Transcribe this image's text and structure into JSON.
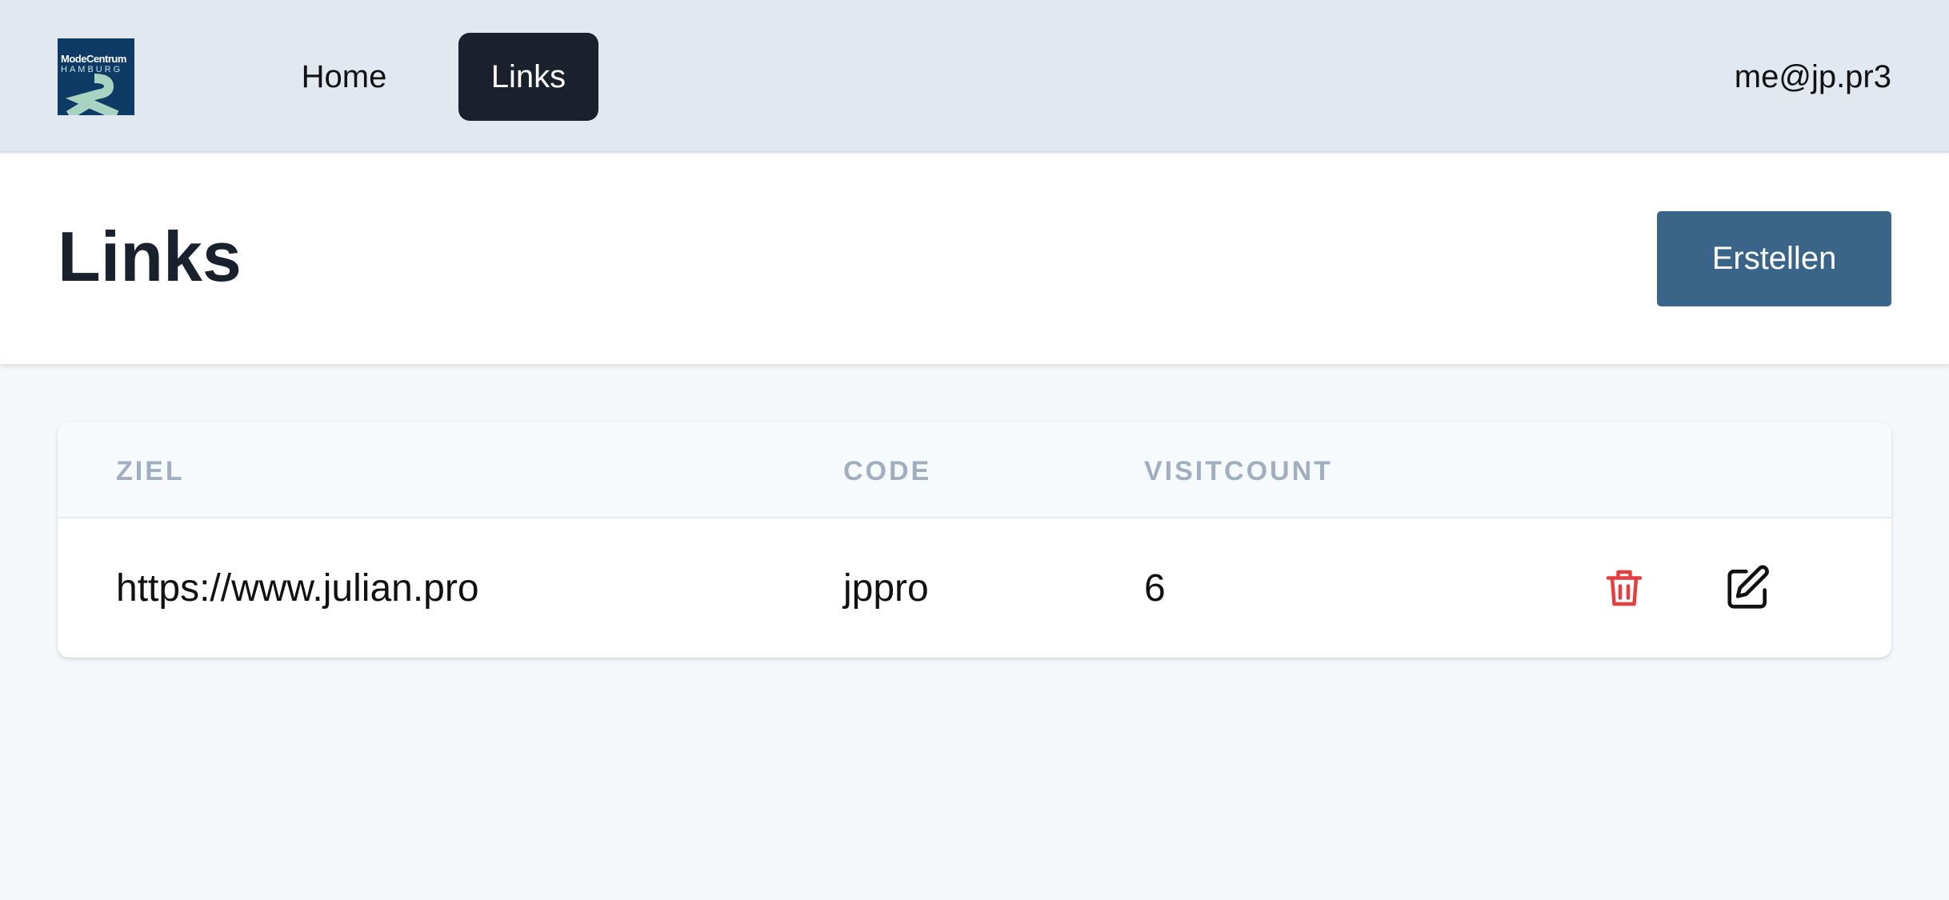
{
  "brand": {
    "logo_line1": "ModeCentrum",
    "logo_line2": "HAMBURG",
    "logo_bg": "#0e3a66",
    "logo_mark_color": "#a9d3c1"
  },
  "nav": {
    "items": [
      {
        "label": "Home",
        "active": false
      },
      {
        "label": "Links",
        "active": true
      }
    ],
    "user_email": "me@jp.pr3"
  },
  "header": {
    "title": "Links",
    "create_label": "Erstellen",
    "create_color": "#3a6588"
  },
  "table": {
    "columns": [
      "ZIEL",
      "CODE",
      "VISITCOUNT"
    ],
    "rows": [
      {
        "ziel": "https://www.julian.pro",
        "code": "jppro",
        "visitcount": "6",
        "delete_icon": "trash-icon",
        "edit_icon": "edit-icon"
      }
    ],
    "delete_color": "#e53e3e"
  }
}
